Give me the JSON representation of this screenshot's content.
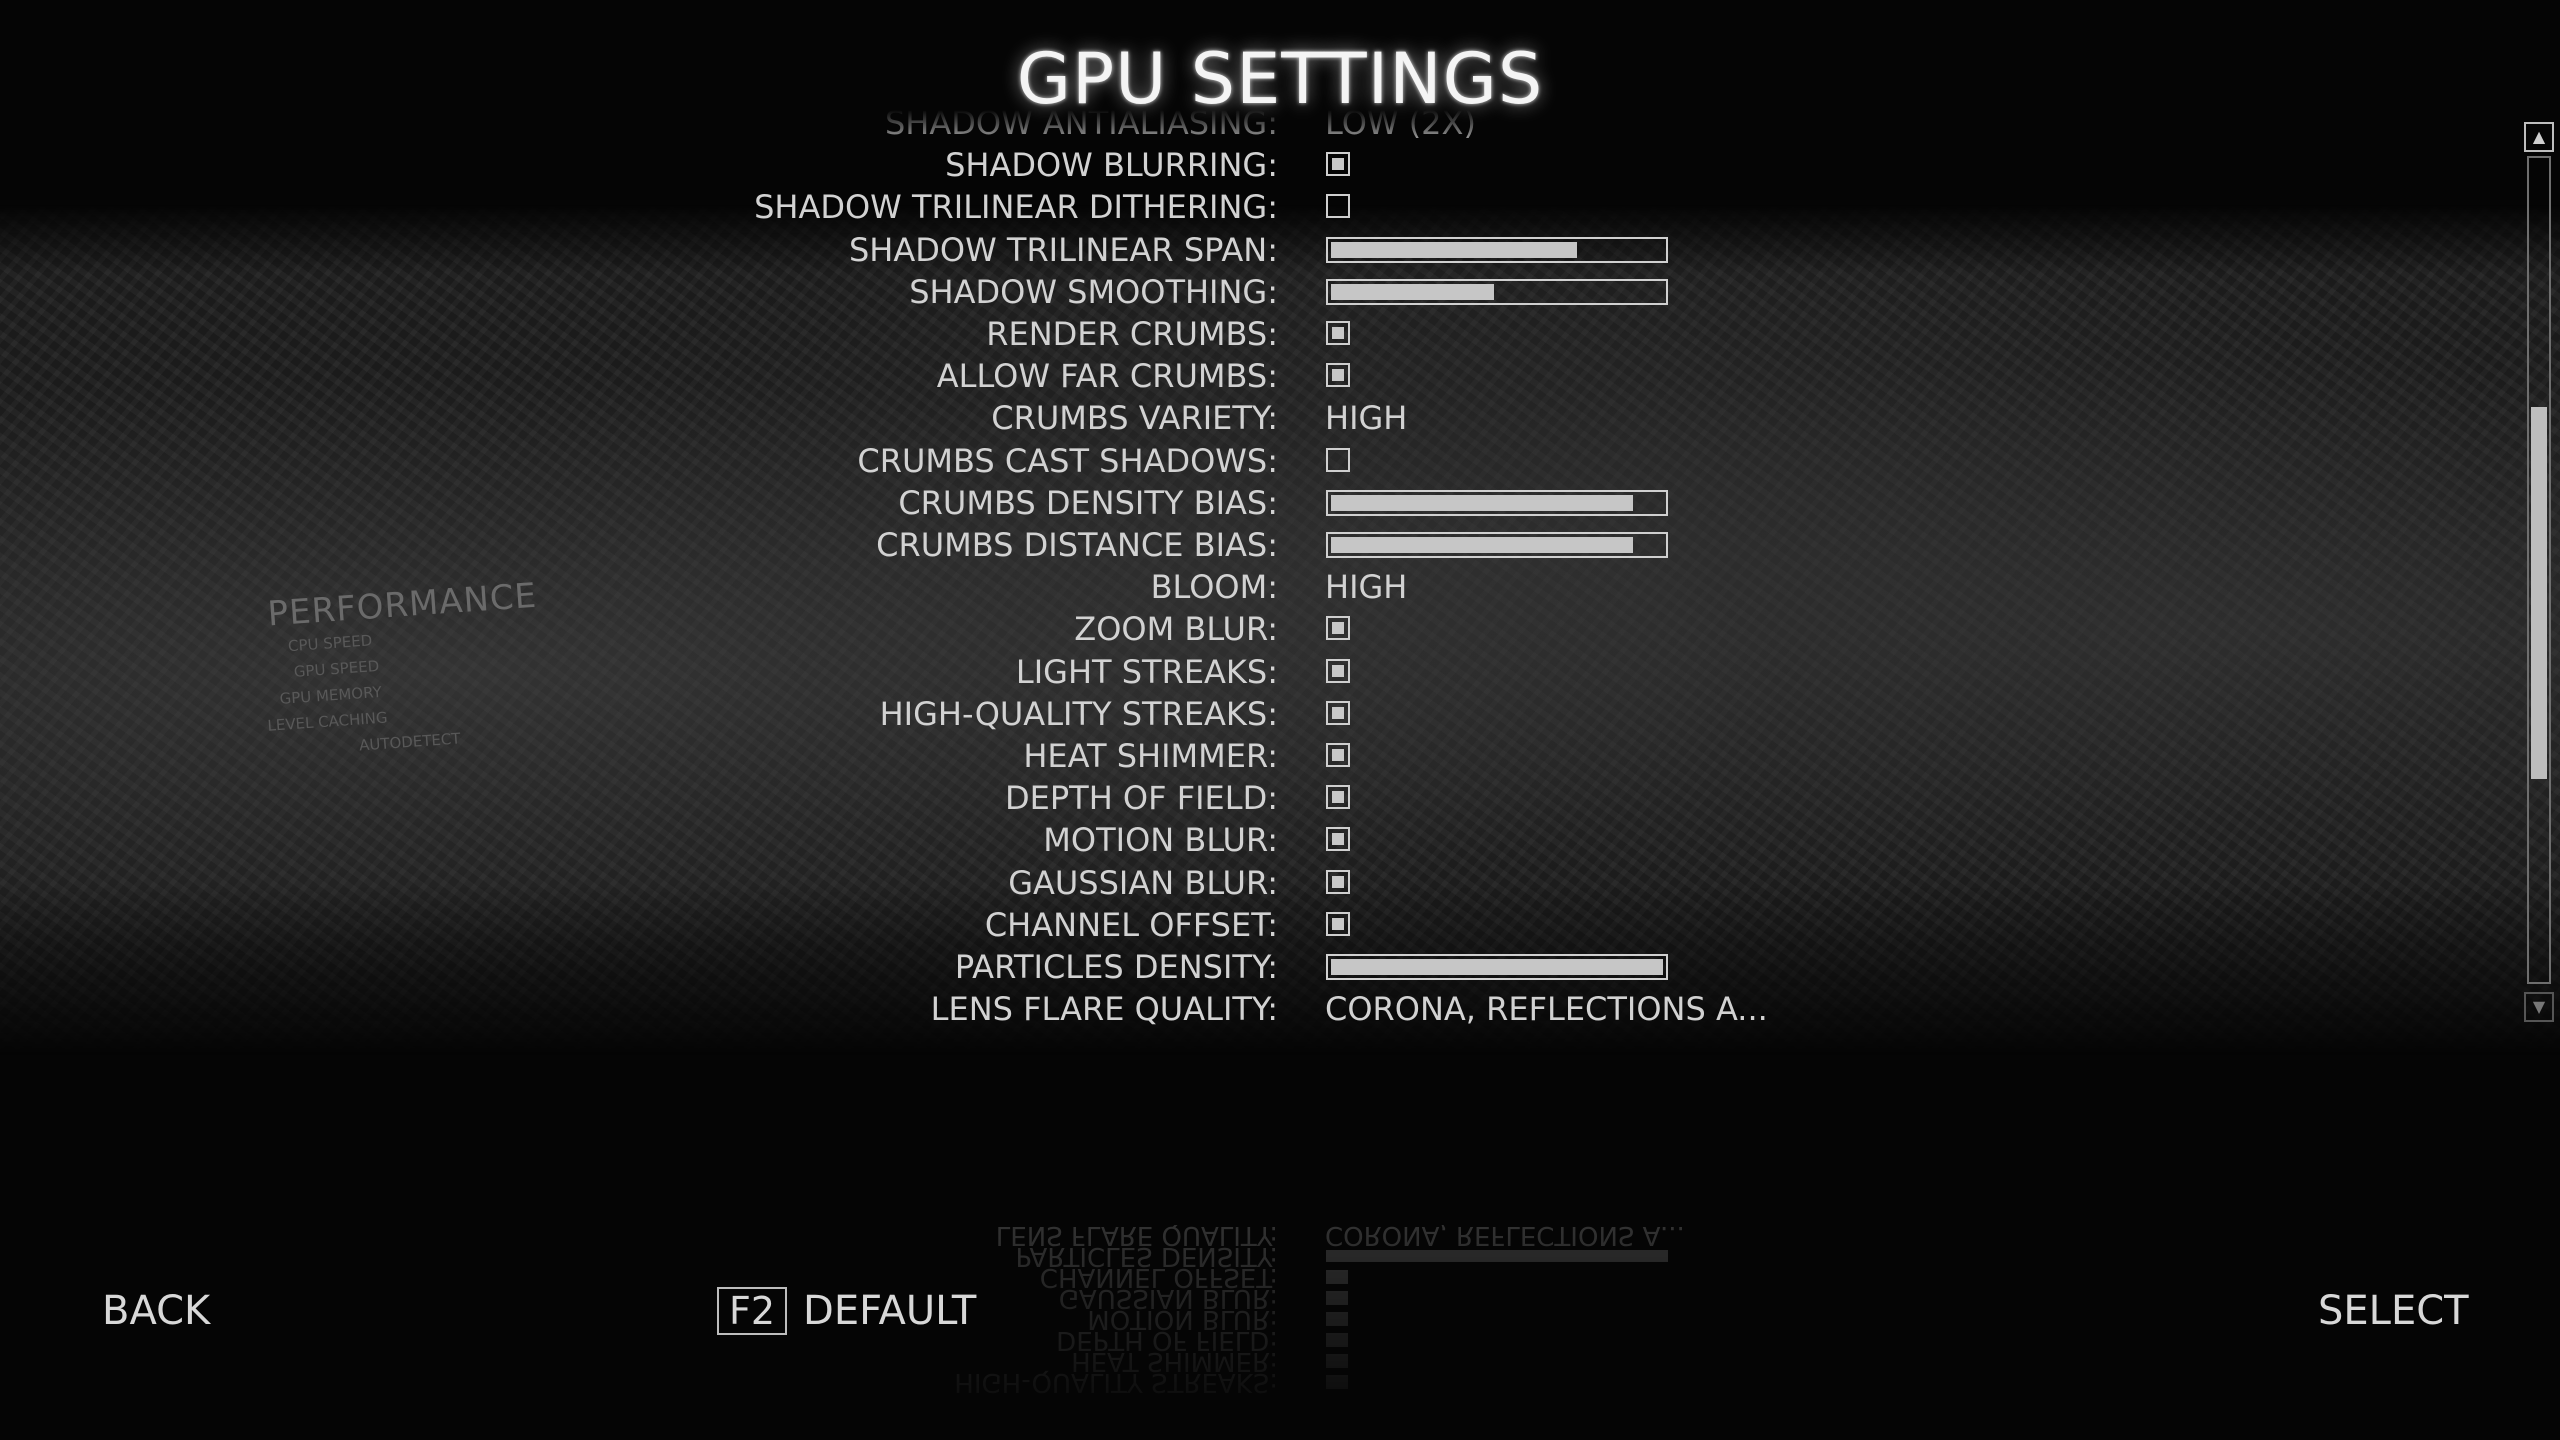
{
  "title": "GPU SETTINGS",
  "settings": [
    {
      "label": "SHADOW ANTIALIASING:",
      "type": "text",
      "value": "LOW (2X)"
    },
    {
      "label": "SHADOW BLURRING:",
      "type": "checkbox",
      "checked": true
    },
    {
      "label": "SHADOW TRILINEAR DITHERING:",
      "type": "checkbox",
      "checked": false
    },
    {
      "label": "SHADOW TRILINEAR SPAN:",
      "type": "slider",
      "level": 0.74
    },
    {
      "label": "SHADOW SMOOTHING:",
      "type": "slider",
      "level": 0.49
    },
    {
      "label": "RENDER CRUMBS:",
      "type": "checkbox",
      "checked": true
    },
    {
      "label": "ALLOW FAR CRUMBS:",
      "type": "checkbox",
      "checked": true
    },
    {
      "label": "CRUMBS VARIETY:",
      "type": "text",
      "value": "HIGH"
    },
    {
      "label": "CRUMBS CAST SHADOWS:",
      "type": "checkbox",
      "checked": false
    },
    {
      "label": "CRUMBS DENSITY BIAS:",
      "type": "slider",
      "level": 0.91
    },
    {
      "label": "CRUMBS DISTANCE BIAS:",
      "type": "slider",
      "level": 0.91
    },
    {
      "label": "BLOOM:",
      "type": "text",
      "value": "HIGH"
    },
    {
      "label": "ZOOM BLUR:",
      "type": "checkbox",
      "checked": true
    },
    {
      "label": "LIGHT STREAKS:",
      "type": "checkbox",
      "checked": true
    },
    {
      "label": "HIGH-QUALITY STREAKS:",
      "type": "checkbox",
      "checked": true
    },
    {
      "label": "HEAT SHIMMER:",
      "type": "checkbox",
      "checked": true
    },
    {
      "label": "DEPTH OF FIELD:",
      "type": "checkbox",
      "checked": true
    },
    {
      "label": "MOTION BLUR:",
      "type": "checkbox",
      "checked": true
    },
    {
      "label": "GAUSSIAN BLUR:",
      "type": "checkbox",
      "checked": true
    },
    {
      "label": "CHANNEL OFFSET:",
      "type": "checkbox",
      "checked": true
    },
    {
      "label": "PARTICLES DENSITY:",
      "type": "slider",
      "level": 1.0
    },
    {
      "label": "LENS FLARE QUALITY:",
      "type": "text",
      "value": "CORONA, REFLECTIONS A..."
    }
  ],
  "background_panel": {
    "heading": "PERFORMANCE",
    "lines": [
      "CPU SPEED",
      "GPU SPEED",
      "GPU MEMORY",
      "LEVEL CACHING",
      "AUTODETECT"
    ]
  },
  "scrollbar": {
    "position": 0.55,
    "up_icon": "arrow-up-icon",
    "down_icon": "arrow-down-icon"
  },
  "footer": {
    "back_label": "BACK",
    "default_key": "F2",
    "default_label": "DEFAULT",
    "select_label": "SELECT"
  }
}
